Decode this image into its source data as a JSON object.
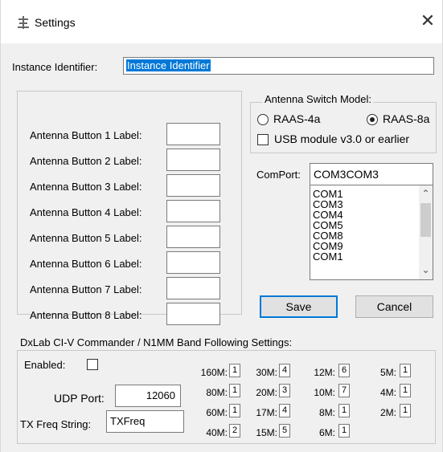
{
  "window": {
    "title": "Settings",
    "close_glyph": "✕"
  },
  "instance": {
    "label": "Instance Identifier:",
    "value": "Instance Identifier"
  },
  "antenna_buttons": [
    {
      "label": "Antenna Button 1 Label:",
      "value": ""
    },
    {
      "label": "Antenna Button 2 Label:",
      "value": ""
    },
    {
      "label": "Antenna Button 3 Label:",
      "value": ""
    },
    {
      "label": "Antenna Button 4 Label:",
      "value": ""
    },
    {
      "label": "Antenna Button 5 Label:",
      "value": ""
    },
    {
      "label": "Antenna Button 6 Label:",
      "value": ""
    },
    {
      "label": "Antenna Button 7 Label:",
      "value": ""
    },
    {
      "label": "Antenna Button 8 Label:",
      "value": ""
    }
  ],
  "switch_model": {
    "title": "Antenna Switch Model:",
    "options": [
      {
        "label": "RAAS-4a",
        "selected": false
      },
      {
        "label": "RAAS-8a",
        "selected": true
      }
    ],
    "usb_label": "USB module v3.0 or earlier",
    "usb_checked": false
  },
  "comport": {
    "label": "ComPort:",
    "value": "COM3COM3",
    "items": [
      "COM1",
      "COM3",
      "COM4",
      "COM5",
      "COM8",
      "COM9",
      "COM1"
    ],
    "scroll_up": "⌃",
    "scroll_down": "⌄"
  },
  "buttons": {
    "save": "Save",
    "cancel": "Cancel"
  },
  "band_following": {
    "title": "DxLab CI-V Commander / N1MM Band Following Settings:",
    "enabled_label": "Enabled:",
    "enabled": false,
    "udp_label": "UDP Port:",
    "udp_value": "12060",
    "txfreq_label": "TX Freq String:",
    "txfreq_value": "TXFreq",
    "bands": [
      {
        "label": "160M:",
        "value": "1"
      },
      {
        "label": "80M:",
        "value": "1"
      },
      {
        "label": "60M:",
        "value": "1"
      },
      {
        "label": "40M:",
        "value": "2"
      },
      {
        "label": "30M:",
        "value": "4"
      },
      {
        "label": "20M:",
        "value": "3"
      },
      {
        "label": "17M:",
        "value": "4"
      },
      {
        "label": "15M:",
        "value": "5"
      },
      {
        "label": "12M:",
        "value": "6"
      },
      {
        "label": "10M:",
        "value": "7"
      },
      {
        "label": "8M:",
        "value": "1"
      },
      {
        "label": "6M:",
        "value": "1"
      },
      {
        "label": "5M:",
        "value": "1"
      },
      {
        "label": "4M:",
        "value": "1"
      },
      {
        "label": "2M:",
        "value": "1"
      }
    ]
  },
  "colors": {
    "accent": "#0078d7",
    "selection": "#0078d7"
  }
}
